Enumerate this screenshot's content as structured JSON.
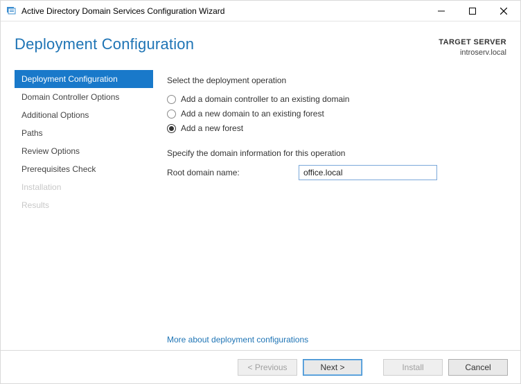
{
  "window": {
    "title": "Active Directory Domain Services Configuration Wizard"
  },
  "header": {
    "page_title": "Deployment Configuration",
    "target_label": "TARGET SERVER",
    "target_server": "introserv.local"
  },
  "sidebar": {
    "items": [
      {
        "label": "Deployment Configuration",
        "state": "active"
      },
      {
        "label": "Domain Controller Options",
        "state": "normal"
      },
      {
        "label": "Additional Options",
        "state": "normal"
      },
      {
        "label": "Paths",
        "state": "normal"
      },
      {
        "label": "Review Options",
        "state": "normal"
      },
      {
        "label": "Prerequisites Check",
        "state": "normal"
      },
      {
        "label": "Installation",
        "state": "disabled"
      },
      {
        "label": "Results",
        "state": "disabled"
      }
    ]
  },
  "content": {
    "select_op_label": "Select the deployment operation",
    "radios": [
      {
        "label": "Add a domain controller to an existing domain",
        "selected": false
      },
      {
        "label": "Add a new domain to an existing forest",
        "selected": false
      },
      {
        "label": "Add a new forest",
        "selected": true
      }
    ],
    "specify_label": "Specify the domain information for this operation",
    "root_domain_label": "Root domain name:",
    "root_domain_value": "office.local",
    "help_link": "More about deployment configurations"
  },
  "footer": {
    "previous": "< Previous",
    "next": "Next >",
    "install": "Install",
    "cancel": "Cancel"
  }
}
